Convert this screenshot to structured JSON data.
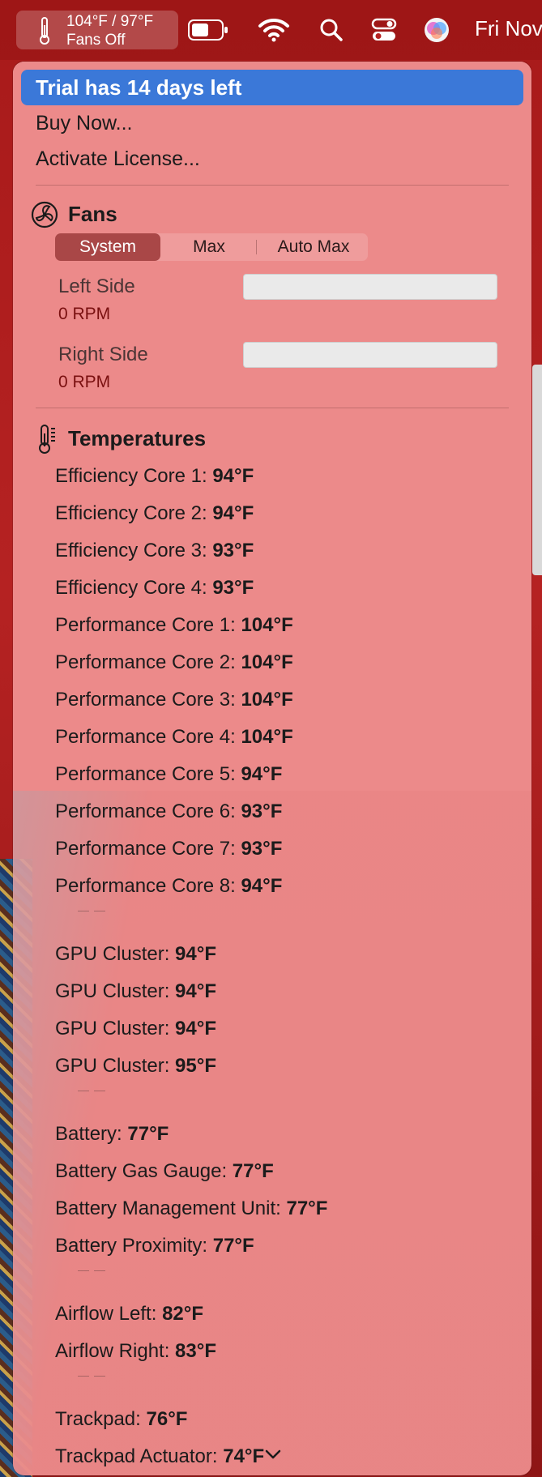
{
  "menubar": {
    "temp_line1": "104°F / 97°F",
    "temp_line2": "Fans Off",
    "icons": [
      "thermometer-icon",
      "battery-icon",
      "wifi-icon",
      "search-icon",
      "control-center-icon",
      "siri-icon"
    ],
    "date": "Fri Nov"
  },
  "menu": {
    "trial": "Trial has 14 days left",
    "buy": "Buy Now...",
    "activate": "Activate License..."
  },
  "fans": {
    "title": "Fans",
    "modes": [
      "System",
      "Max",
      "Auto Max"
    ],
    "selected_mode": "System",
    "left": {
      "label": "Left Side",
      "rpm": "0 RPM"
    },
    "right": {
      "label": "Right Side",
      "rpm": "0 RPM"
    }
  },
  "temperatures": {
    "title": "Temperatures",
    "groups": [
      [
        {
          "label": "Efficiency Core 1:",
          "value": "94°F"
        },
        {
          "label": "Efficiency Core 2:",
          "value": "94°F"
        },
        {
          "label": "Efficiency Core 3:",
          "value": "93°F"
        },
        {
          "label": "Efficiency Core 4:",
          "value": "93°F"
        },
        {
          "label": "Performance Core 1:",
          "value": "104°F"
        },
        {
          "label": "Performance Core 2:",
          "value": "104°F"
        },
        {
          "label": "Performance Core 3:",
          "value": "104°F"
        },
        {
          "label": "Performance Core 4:",
          "value": "104°F"
        },
        {
          "label": "Performance Core 5:",
          "value": "94°F"
        },
        {
          "label": "Performance Core 6:",
          "value": "93°F"
        },
        {
          "label": "Performance Core 7:",
          "value": "93°F"
        },
        {
          "label": "Performance Core 8:",
          "value": "94°F"
        }
      ],
      [
        {
          "label": "GPU Cluster:",
          "value": "94°F"
        },
        {
          "label": "GPU Cluster:",
          "value": "94°F"
        },
        {
          "label": "GPU Cluster:",
          "value": "94°F"
        },
        {
          "label": "GPU Cluster:",
          "value": "95°F"
        }
      ],
      [
        {
          "label": "Battery:",
          "value": "77°F"
        },
        {
          "label": "Battery Gas Gauge:",
          "value": "77°F"
        },
        {
          "label": "Battery Management Unit:",
          "value": "77°F"
        },
        {
          "label": "Battery Proximity:",
          "value": "77°F"
        }
      ],
      [
        {
          "label": "Airflow Left:",
          "value": "82°F"
        },
        {
          "label": "Airflow Right:",
          "value": "83°F"
        }
      ],
      [
        {
          "label": "Trackpad:",
          "value": "76°F"
        },
        {
          "label": "Trackpad Actuator:",
          "value": "74°F"
        }
      ]
    ]
  },
  "colors": {
    "highlight": "#3b78d8",
    "panel": "#ec8a8a",
    "active_segment": "#a94747",
    "rpm_text": "#7a1010"
  }
}
